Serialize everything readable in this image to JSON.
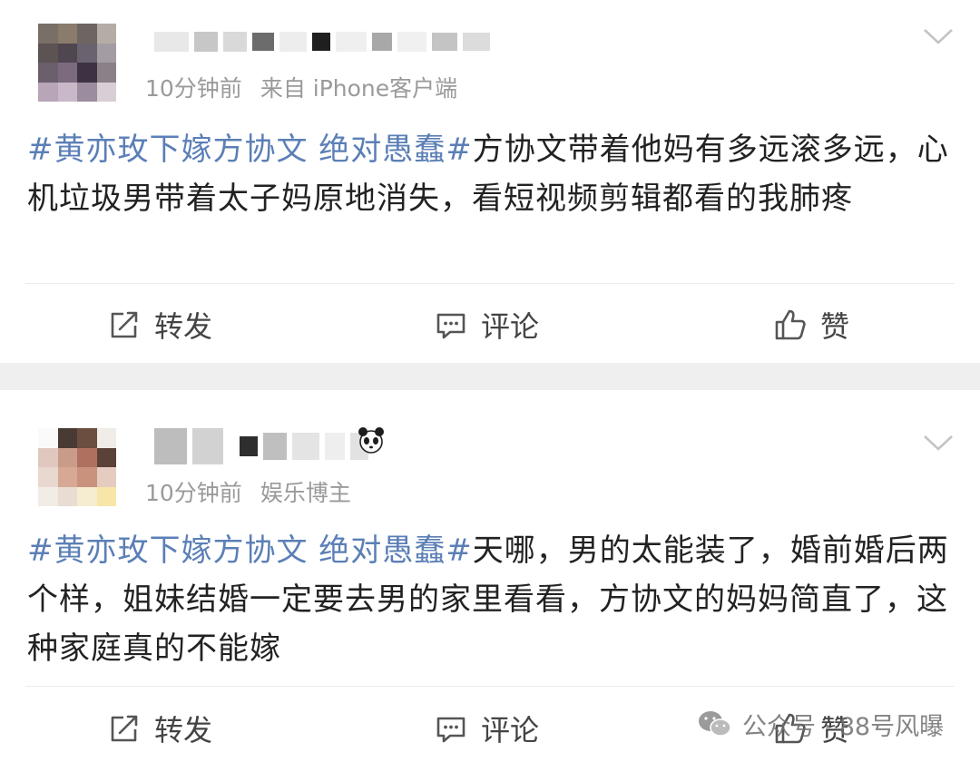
{
  "posts": [
    {
      "time": "10分钟前",
      "source": "来自 iPhone客户端",
      "hashtag": "#黄亦玫下嫁方协文 绝对愚蠢#",
      "body": "方协文带着他妈有多远滚多远，心机垃圾男带着太子妈原地消失，看短视频剪辑都看的我肺疼",
      "actions": {
        "repost": "转发",
        "comment": "评论",
        "like": "赞"
      }
    },
    {
      "time": "10分钟前",
      "source": "娱乐博主",
      "hashtag": "#黄亦玫下嫁方协文 绝对愚蠢#",
      "body": "天哪，男的太能装了，婚前婚后两个样，姐妹结婚一定要去男的家里看看，方协文的妈妈简直了，这种家庭真的不能嫁",
      "actions": {
        "repost": "转发",
        "comment": "评论",
        "like": "赞"
      }
    }
  ],
  "watermark": "公众号 · 88号风曝",
  "colors": {
    "hashtag": "#5b7fb6",
    "meta": "#9a9a9a",
    "separator": "#efefef"
  }
}
